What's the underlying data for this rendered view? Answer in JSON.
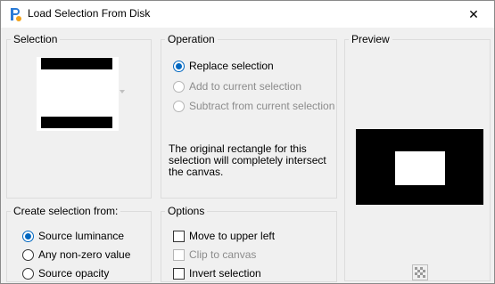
{
  "window": {
    "title": "Load Selection From Disk",
    "close_label": "✕"
  },
  "selection": {
    "label": "Selection"
  },
  "operation": {
    "label": "Operation",
    "options": [
      {
        "label": "Replace selection",
        "checked": true,
        "enabled": true
      },
      {
        "label": "Add to current selection",
        "checked": false,
        "enabled": false
      },
      {
        "label": "Subtract from current selection",
        "checked": false,
        "enabled": false
      }
    ],
    "description": "The original rectangle for this selection will completely intersect the canvas."
  },
  "preview": {
    "label": "Preview"
  },
  "create_from": {
    "label": "Create selection from:",
    "options": [
      {
        "label": "Source luminance",
        "checked": true,
        "enabled": true
      },
      {
        "label": "Any non-zero value",
        "checked": false,
        "enabled": true
      },
      {
        "label": "Source opacity",
        "checked": false,
        "enabled": true
      }
    ]
  },
  "options": {
    "label": "Options",
    "items": [
      {
        "label": "Move to upper left",
        "checked": false,
        "enabled": true
      },
      {
        "label": "Clip to canvas",
        "checked": false,
        "enabled": false
      },
      {
        "label": "Invert selection",
        "checked": false,
        "enabled": true
      }
    ]
  },
  "colors": {
    "accent": "#0067c0",
    "disabled_text": "#8c8c8c"
  }
}
